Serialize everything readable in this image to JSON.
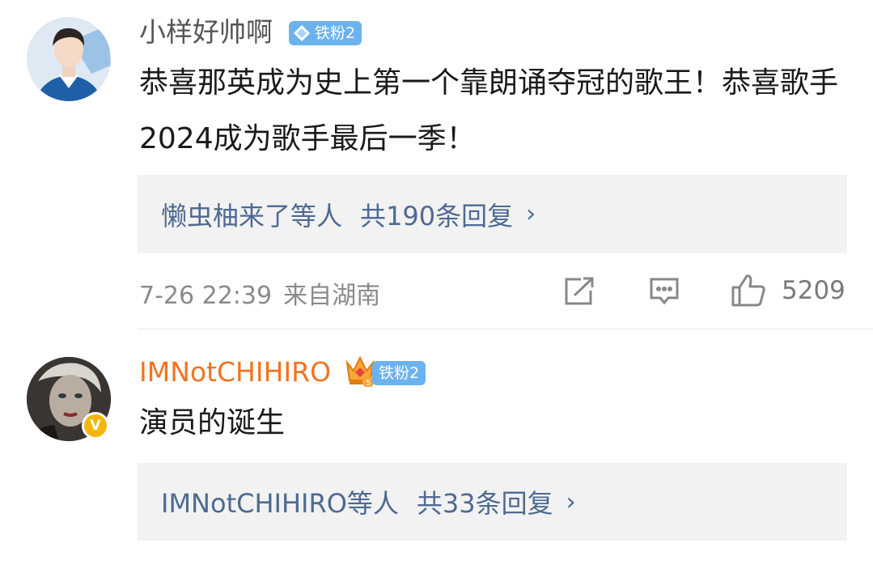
{
  "comments": [
    {
      "username": "小样好帅啊",
      "fan_badge": "铁粉2",
      "text": "恭喜那英成为史上第一个靠朗诵夺冠的歌王！恭喜歌手2024成为歌手最后一季！",
      "replies": {
        "who": "懒虫柚来了等人",
        "count": "共190条回复",
        "chevron": "›"
      },
      "meta": {
        "time": "7-26 22:39",
        "location": "来自湖南"
      },
      "likes": "5209"
    },
    {
      "username": "IMNotCHIHIRO",
      "verified_badge": "V",
      "crown_level": "5",
      "fan_badge": "铁粉2",
      "text": "演员的诞生",
      "replies": {
        "who": "IMNotCHIHIRO等人",
        "count": "共33条回复",
        "chevron": "›"
      }
    }
  ],
  "icons": [
    "share-icon",
    "comment-icon",
    "like-icon",
    "diamond-icon",
    "crown-icon"
  ],
  "colors": {
    "reply_link": "#4d6a93",
    "orange_name": "#f2731f",
    "badge_blue": "#6cb3ee",
    "reply_bg": "#f2f2f2"
  }
}
